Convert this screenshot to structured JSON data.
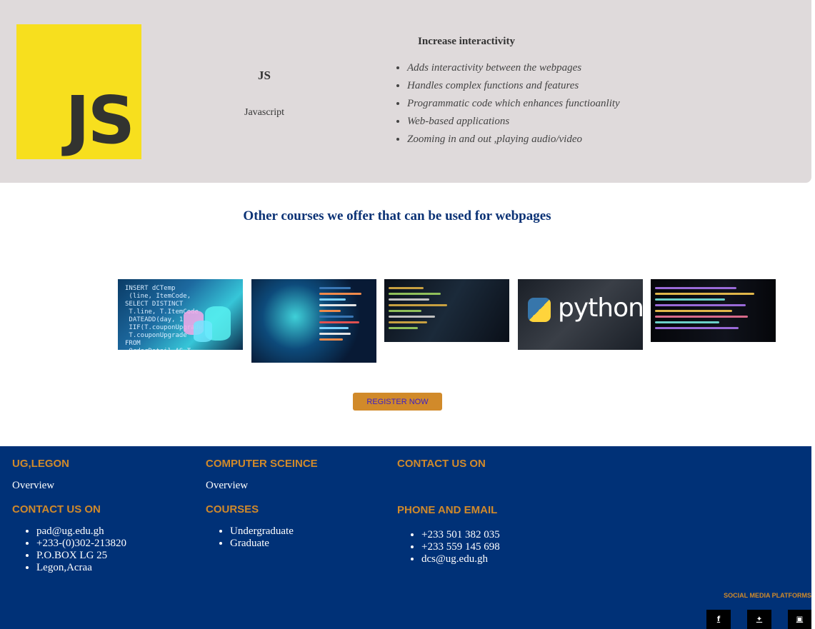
{
  "course": {
    "logo_text": "JS",
    "title": "JS",
    "subtitle": "Javascript",
    "features_heading": "Increase interactivity",
    "features": [
      "Adds interactivity between the webpages",
      "Handles complex functions and features",
      "Programmatic code which enhances functioanlity",
      "Web-based applications",
      "Zooming in and out ,playing audio/video"
    ]
  },
  "offers": {
    "heading": "Other courses we offer that can be used for webpages",
    "python_label": "python",
    "sql_snippet": "INSERT dCTemp\n (line, ItemCode,\nSELECT DISTINCT\n T.line, T.ItemCode\n DATEADD(day, 1\n IIF(T.couponUpgrade\n T.couponUpgrade\nFROM\n OrderDetail AS T"
  },
  "register": {
    "label": "REGISTER NOW"
  },
  "footer": {
    "col1": {
      "heading": "UG,LEGON",
      "link": "Overview",
      "contact_heading": "CONTACT US ON",
      "items": [
        "pad@ug.edu.gh",
        "+233-(0)302-213820",
        "P.O.BOX LG 25",
        "Legon,Acraa"
      ]
    },
    "col2": {
      "heading": "COMPUTER SCEINCE",
      "link": "Overview",
      "courses_heading": "COURSES",
      "items": [
        "Undergraduate",
        "Graduate"
      ]
    },
    "col3": {
      "heading": "CONTACT US ON",
      "phone_heading": "PHONE AND EMAIL",
      "items": [
        "+233 501 382 035",
        "+233 559 145 698",
        "dcs@ug.edu.gh"
      ]
    },
    "social": {
      "label": "SOCIAL MEDIA PLATFORMS",
      "icons": [
        "facebook-icon",
        "twitter-icon",
        "instagram-icon"
      ]
    }
  },
  "colors": {
    "panel_bg": "#dfdadb",
    "js_yellow": "#f7df1e",
    "heading_blue": "#0b3275",
    "accent_orange": "#d18a2a",
    "footer_bg": "#003177"
  }
}
